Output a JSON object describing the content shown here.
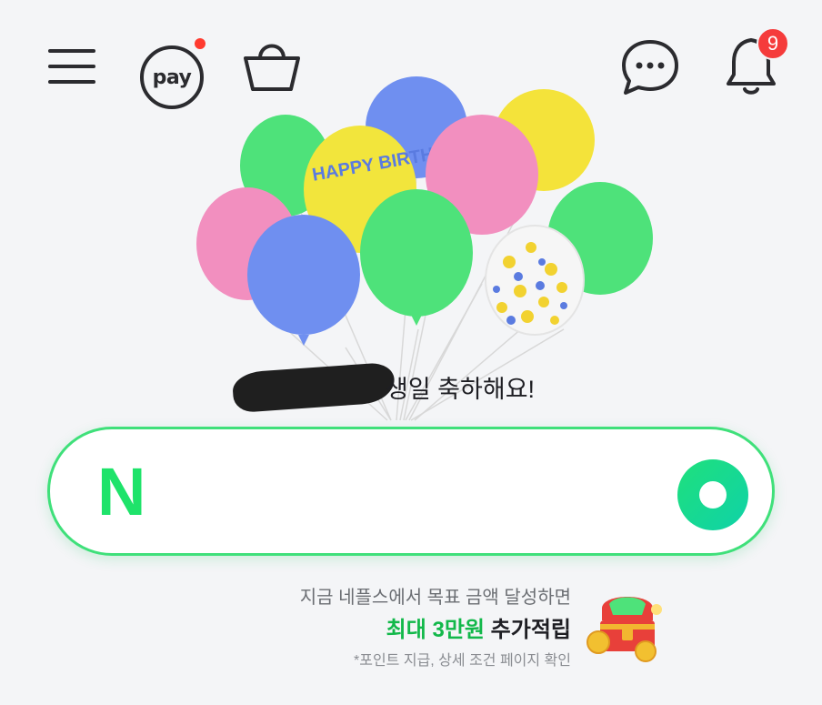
{
  "header": {
    "pay_label": "pay",
    "notification_count": "9",
    "icons": [
      "menu-icon",
      "pay-icon",
      "shopping-bag-icon",
      "chat-icon",
      "bell-icon"
    ]
  },
  "balloon_text": "HAPPY BIRTHDAY",
  "greeting": {
    "text": "생일 축하해요!"
  },
  "search": {
    "logo_text": "N",
    "value": "",
    "placeholder": ""
  },
  "promo": {
    "line1": "지금 네플스에서 목표 금액 달성하면",
    "line2_green": "최대 3만원",
    "line2_dark": " 추가적립",
    "line3": "*포인트 지급, 상세 조건 페이지 확인"
  },
  "colors": {
    "accent_green": "#1ee36a",
    "badge_red": "#f53b3b",
    "background": "#f4f5f7"
  }
}
